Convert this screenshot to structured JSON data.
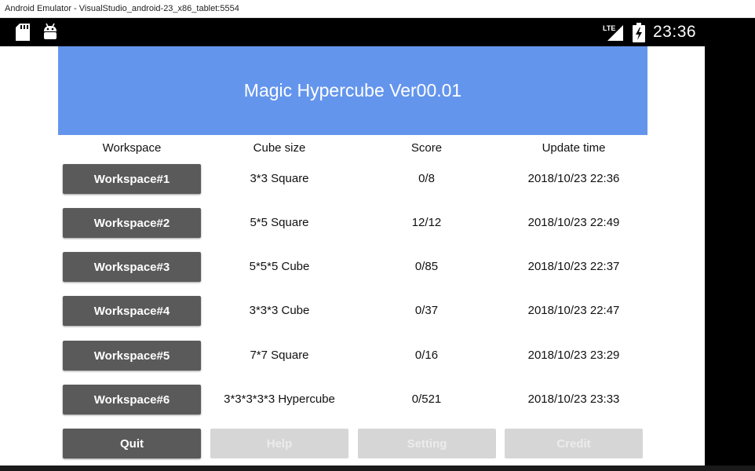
{
  "window": {
    "title": "Android Emulator - VisualStudio_android-23_x86_tablet:5554"
  },
  "statusbar": {
    "time": "23:36",
    "network": "LTE",
    "icons": [
      "sd-card-icon",
      "android-icon",
      "lte-signal-icon",
      "battery-charging-icon"
    ]
  },
  "app": {
    "title": "Magic Hypercube Ver00.01"
  },
  "table": {
    "headers": {
      "workspace": "Workspace",
      "cube_size": "Cube size",
      "score": "Score",
      "update_time": "Update time"
    },
    "rows": [
      {
        "button": "Workspace#1",
        "cube_size": "3*3 Square",
        "score": "0/8",
        "update_time": "2018/10/23 22:36"
      },
      {
        "button": "Workspace#2",
        "cube_size": "5*5 Square",
        "score": "12/12",
        "update_time": "2018/10/23 22:49"
      },
      {
        "button": "Workspace#3",
        "cube_size": "5*5*5 Cube",
        "score": "0/85",
        "update_time": "2018/10/23 22:37"
      },
      {
        "button": "Workspace#4",
        "cube_size": "3*3*3 Cube",
        "score": "0/37",
        "update_time": "2018/10/23 22:47"
      },
      {
        "button": "Workspace#5",
        "cube_size": "7*7 Square",
        "score": "0/16",
        "update_time": "2018/10/23 23:29"
      },
      {
        "button": "Workspace#6",
        "cube_size": "3*3*3*3*3 Hypercube",
        "score": "0/521",
        "update_time": "2018/10/23 23:33"
      }
    ]
  },
  "buttons": {
    "quit": "Quit",
    "help": "Help",
    "setting": "Setting",
    "credit": "Credit"
  },
  "colors": {
    "banner": "#6495ed",
    "button": "#5a5a5a",
    "disabled_button": "#d6d6d6"
  }
}
